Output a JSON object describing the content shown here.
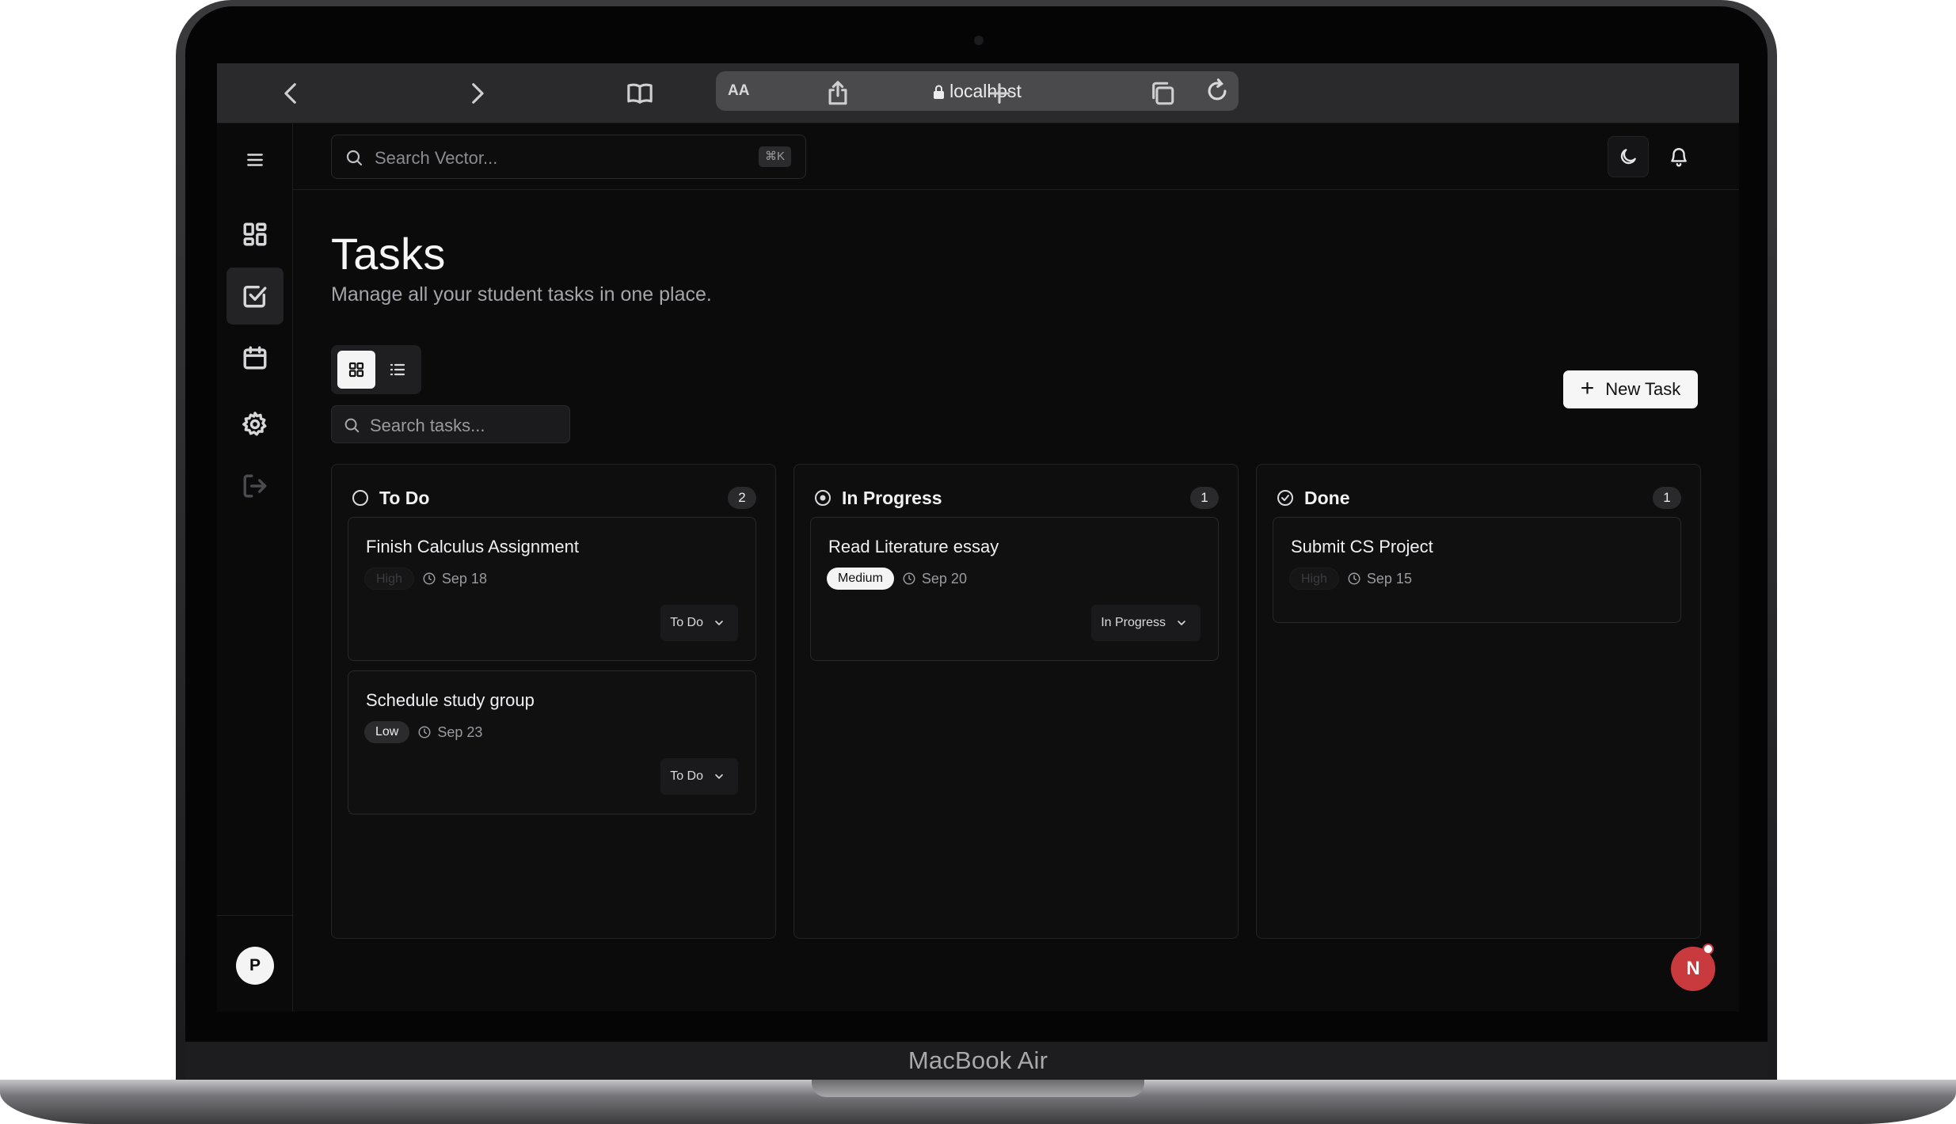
{
  "device": {
    "label": "MacBook Air"
  },
  "browser": {
    "text_size_label": "AA",
    "url": "localhost"
  },
  "topbar": {
    "search_placeholder": "Search Vector...",
    "search_shortcut": "⌘K"
  },
  "page": {
    "title": "Tasks",
    "subtitle": "Manage all your student tasks in one place."
  },
  "toolbar": {
    "search_placeholder": "Search tasks...",
    "new_task_label": "New Task"
  },
  "sidebar": {
    "items": [
      "dashboard-icon",
      "tasks-icon",
      "calendar-icon",
      "settings-icon",
      "logout-icon"
    ],
    "user_initial": "P"
  },
  "columns": [
    {
      "title": "To Do",
      "count": "2",
      "cards": [
        {
          "title": "Finish Calculus Assignment",
          "priority": "High",
          "due": "Sep 18",
          "status": "To Do"
        },
        {
          "title": "Schedule study group",
          "priority": "Low",
          "due": "Sep 23",
          "status": "To Do"
        }
      ]
    },
    {
      "title": "In Progress",
      "count": "1",
      "cards": [
        {
          "title": "Read Literature essay",
          "priority": "Medium",
          "due": "Sep 20",
          "status": "In Progress"
        }
      ]
    },
    {
      "title": "Done",
      "count": "1",
      "cards": [
        {
          "title": "Submit CS Project",
          "priority": "High",
          "due": "Sep 15"
        }
      ]
    }
  ],
  "fab": {
    "initial": "N"
  },
  "colors": {
    "accent_red": "#c93a3e",
    "background": "#0b0b0c",
    "surface": "#0e0e0f"
  }
}
